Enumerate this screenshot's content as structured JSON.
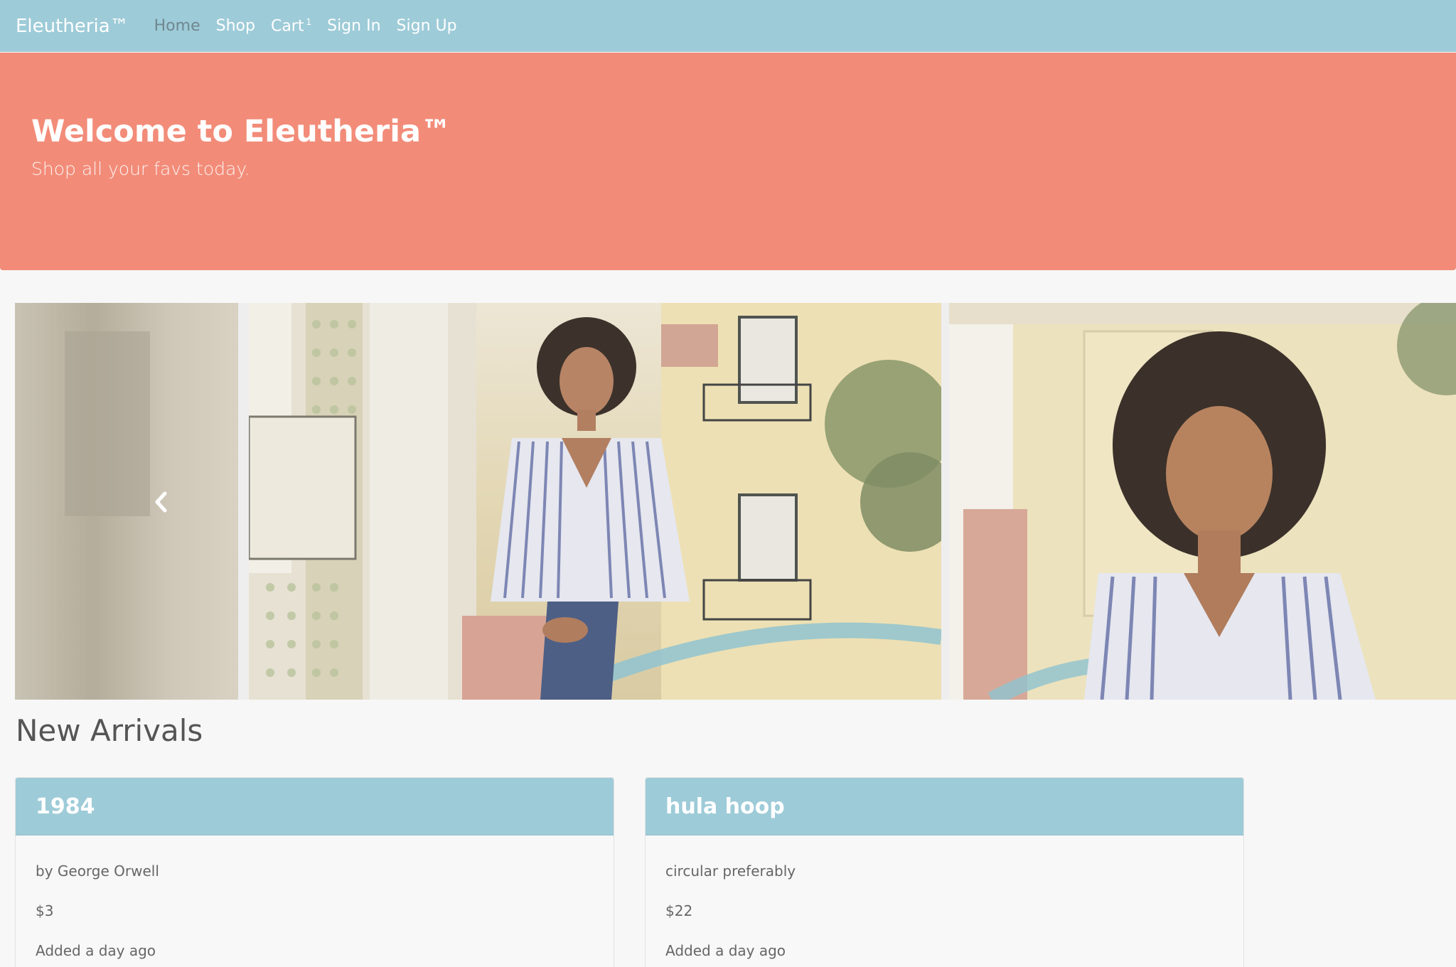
{
  "navbar": {
    "brand": "Eleutheria™",
    "links": [
      {
        "label": "Home",
        "active": true
      },
      {
        "label": "Shop",
        "active": false
      },
      {
        "label": "Cart",
        "active": false
      },
      {
        "label": "Sign In",
        "active": false
      },
      {
        "label": "Sign Up",
        "active": false
      }
    ],
    "cart_count": "1"
  },
  "jumbotron": {
    "title": "Welcome to Eleutheria™",
    "subtitle": "Shop all your favs today."
  },
  "carousel": {
    "prev_icon": "chevron-left-icon",
    "indicator_count": 3,
    "active_indicator": 0
  },
  "new_arrivals": {
    "title": "New Arrivals",
    "products": [
      {
        "name": "1984",
        "description": "by George Orwell",
        "price": "$3",
        "added": "Added a day ago"
      },
      {
        "name": "hula hoop",
        "description": "circular preferably",
        "price": "$22",
        "added": "Added a day ago"
      }
    ]
  },
  "colors": {
    "navbar": "#9ecbd8",
    "jumbotron": "#f28c79",
    "card_header": "#9ecbd8",
    "background": "#f7f7f7"
  }
}
